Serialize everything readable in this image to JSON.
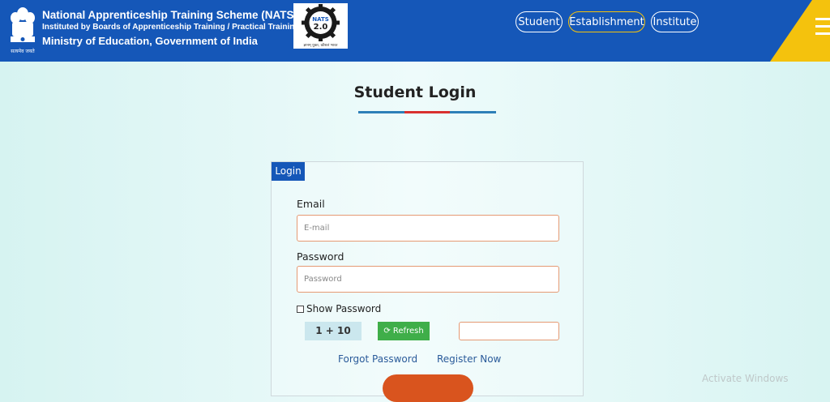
{
  "header": {
    "title": "National Apprenticeship Training Scheme (NATS)",
    "subtitle": "Instituted by Boards of Apprenticeship Training / Practical Training",
    "ministry": "Ministry of Education, Government of India",
    "emblem_caption": "सत्यमेव जयते",
    "logo_text": "NATS",
    "logo_version": "2.0",
    "logo_tagline": "ज्ञानम् युक्त, कौशलं भारत",
    "nav": [
      {
        "label": "Student"
      },
      {
        "label": "Establishment"
      },
      {
        "label": "Institute"
      }
    ]
  },
  "page": {
    "title": "Student Login"
  },
  "form": {
    "tab_label": "Login",
    "email_label": "Email",
    "email_placeholder": "E-mail",
    "password_label": "Password",
    "password_placeholder": "Password",
    "show_password_label": "Show Password",
    "captcha_text": "1 + 10",
    "refresh_label": "Refresh",
    "forgot_password": "Forgot Password",
    "register_now": "Register Now"
  },
  "watermark": "Activate Windows",
  "colors": {
    "header_blue": "#1557b8",
    "accent_yellow": "#f4c20d",
    "input_border": "#e59a74",
    "refresh_green": "#3fae49",
    "login_orange": "#d9541e"
  }
}
